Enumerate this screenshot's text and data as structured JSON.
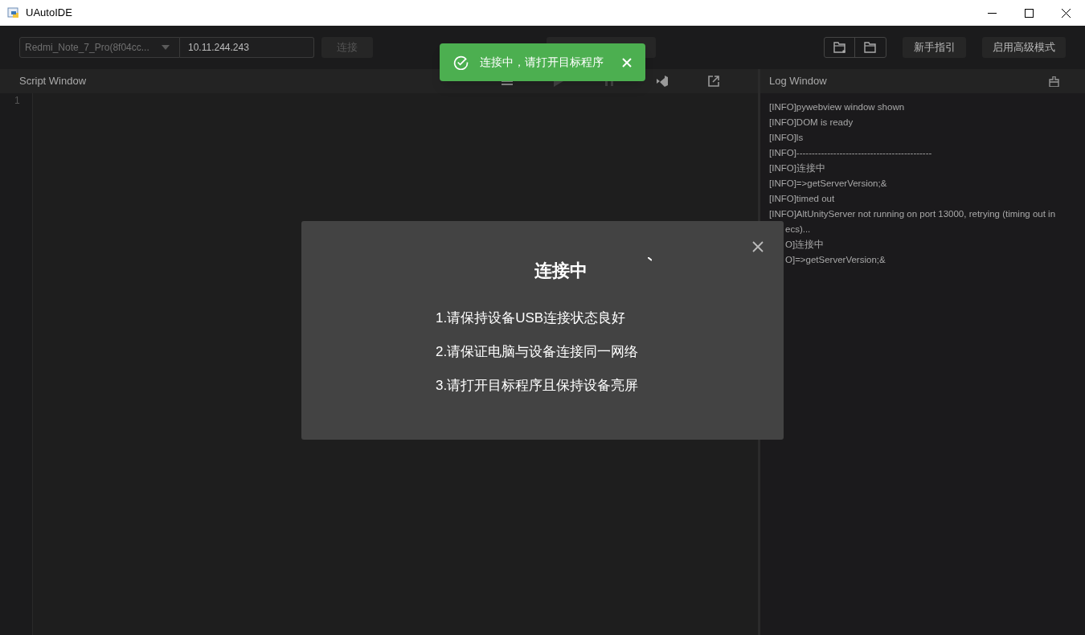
{
  "window": {
    "title": "UAutoIDE"
  },
  "toolbar": {
    "device_select": {
      "value": "Redmi_Note_7_Pro(8f04cc..."
    },
    "ip_field": {
      "value": "10.11.244.243"
    },
    "connect_button": "连接",
    "guide_button": "新手指引",
    "advanced_button": "启用高级模式"
  },
  "script_window": {
    "title": "Script Window",
    "line_numbers": [
      "1"
    ]
  },
  "log_window": {
    "title": "Log Window",
    "lines": [
      {
        "text": "[INFO]pywebview window shown",
        "kind": "full"
      },
      {
        "text": "[INFO]DOM is ready",
        "kind": "full"
      },
      {
        "text": "[INFO]ls",
        "kind": "full"
      },
      {
        "text": "[INFO]--------------------------------------------",
        "kind": "full"
      },
      {
        "text": "[INFO]连接中",
        "kind": "full"
      },
      {
        "text": "[INFO]=>getServerVersion;&",
        "kind": "full"
      },
      {
        "text": "[INFO]timed out",
        "kind": "full"
      },
      {
        "text": "[INFO]AltUnityServer not running on port 13000, retrying (timing out in",
        "kind": "full"
      },
      {
        "text": "ecs)...",
        "kind": "clipped"
      },
      {
        "text": "O]连接中",
        "kind": "clipped"
      },
      {
        "text": "O]=>getServerVersion;&",
        "kind": "clipped"
      }
    ]
  },
  "toast": {
    "message": "连接中，请打开目标程序"
  },
  "dialog": {
    "title": "连接中",
    "steps": [
      "1.请保持设备USB连接状态良好",
      "2.请保证电脑与设备连接同一网络",
      "3.请打开目标程序且保持设备亮屏"
    ]
  }
}
